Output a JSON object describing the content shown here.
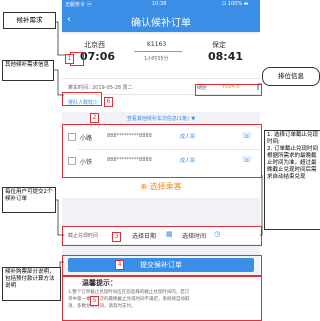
{
  "statusbar": {
    "carrier": "无服务令 ⓜ",
    "time": "10:38",
    "battery": "⊡ 100% ▬"
  },
  "header": {
    "back": "‹",
    "title": "确认候补订单"
  },
  "trip": {
    "from_station": "北京西",
    "from_time": "07:06",
    "train_no": "K1163",
    "duration": "1小时35分",
    "to_station": "保定",
    "to_time": "08:41"
  },
  "order_info": {
    "date_label": "乘车时间：",
    "date_value": "2019-05-28 周二",
    "seat_label": "硬卧",
    "price": "¥104.5",
    "queue_label": "排队人数较少"
  },
  "more_trains": {
    "label": "查看其他候补车次信息(1条)",
    "chevron": "▼"
  },
  "passengers": [
    {
      "name": "小路",
      "id": "888*********8888",
      "type": "成人票"
    },
    {
      "name": "小铁",
      "id": "888*********8888",
      "type": "成人票"
    }
  ],
  "add_passenger": {
    "label": "选择乘客",
    "icon": "⊕"
  },
  "cutoff": {
    "label": "截止兑现时间",
    "date_placeholder": "选择日期",
    "time_placeholder": "选择时间"
  },
  "submit": {
    "label": "提交候补订单"
  },
  "tips": {
    "title": "温馨提示：",
    "line1": "1.整个订单截止兑现时间应在您选择的截止兑现时间内，若订",
    "line2": "单中第一乘车车次的最晚截止兑现时间不满足，系统将自动取",
    "line3": "消，多数兑现时间，请及时支付。"
  },
  "annotations": {
    "n1": "候补需求",
    "n2": "其他候补需求信息",
    "n3": "每位用户可提交2个候补订单",
    "n4": "候补购票部分说明，包括预付款计算方法说明",
    "n5": "排位信息",
    "n6": "1. 选择订单截止兑现时间;\n2. 订单截止兑现时间根据所需求的最晚截止时间为准，超过最晚截止兑现时间后需求自动结束兑现",
    "n1_idx": "1",
    "n2_idx": "2",
    "n3_idx": "3",
    "n4_idx": "4",
    "n5_idx": "5",
    "n6_idx": "6"
  }
}
